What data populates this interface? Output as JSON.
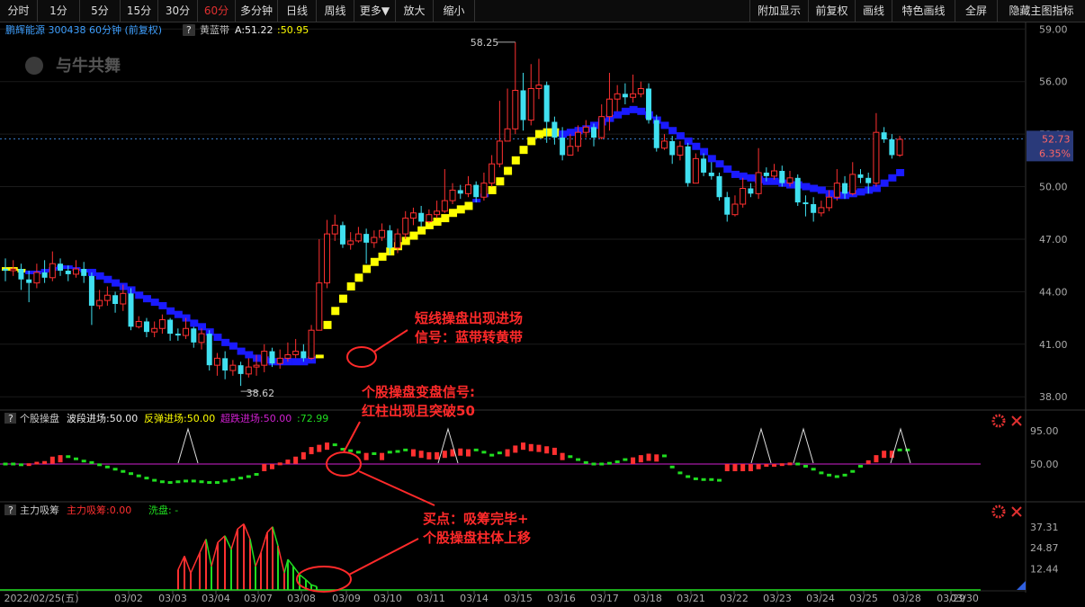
{
  "toolbar": {
    "left": [
      "分时",
      "1分",
      "5分",
      "15分",
      "30分",
      "60分",
      "多分钟",
      "日线",
      "周线",
      "更多▼",
      "放大",
      "缩小"
    ],
    "right": [
      "附加显示",
      "前复权",
      "画线",
      "特色画线",
      "全屏",
      "隐藏主图指标"
    ],
    "active": "60分"
  },
  "main": {
    "stock_title": "鹏辉能源 300438 60分钟 (前复权)",
    "help_icon": "?",
    "indicator_name": "黄蓝带",
    "value_a": "A:51.22",
    "value_b": ":50.95",
    "watermark": "与牛共舞",
    "high_label": "58.25",
    "low_label": "38.62",
    "current_price": "52.73",
    "current_pct": "6.35%",
    "y_ticks": [
      "59.00",
      "56.00",
      "53.00",
      "50.00",
      "47.00",
      "44.00",
      "41.00",
      "38.00"
    ]
  },
  "panel1": {
    "title": "个股操盘",
    "s1": "波段进场:50.00",
    "s2": "反弹进场:50.00",
    "s3": "超跌进场:50.00",
    "s4": ":72.99",
    "y_ticks": [
      "95.00",
      "50.00"
    ]
  },
  "panel2": {
    "title": "主力吸筹",
    "s1": "主力吸筹:0.00",
    "s2": "洗盘: -",
    "y_ticks": [
      "37.31",
      "24.87",
      "12.44"
    ]
  },
  "x_axis": [
    "2022/02/25(五)",
    "03/02",
    "03/03",
    "03/04",
    "03/07",
    "03/08",
    "03/09",
    "03/10",
    "03/11",
    "03/14",
    "03/15",
    "03/16",
    "03/17",
    "03/18",
    "03/21",
    "03/22",
    "03/23",
    "03/24",
    "03/25",
    "03/28",
    "03/29",
    "03/30"
  ],
  "annotations": {
    "a1_line1": "短线操盘出现进场",
    "a1_line2": "信号：蓝带转黄带",
    "a2_line1": "个股操盘变盘信号:",
    "a2_line2": "红柱出现且突破50",
    "a3_line1": "买点：吸筹完毕+",
    "a3_line2": "个股操盘柱体上移"
  },
  "colors": {
    "up": "#ff3030",
    "down": "#40e0f0",
    "yellow_band": "#ffff00",
    "blue_band": "#1a1aff",
    "magenta": "#d020d0",
    "green": "#20dd20",
    "annotation": "#ff2a2a"
  },
  "chart_data": {
    "type": "candlestick",
    "y_range": [
      38,
      59.5
    ],
    "candles": [
      [
        45.3,
        45.2,
        45.9,
        44.6
      ],
      [
        45.2,
        45.3,
        45.8,
        44.9
      ],
      [
        45.3,
        44.7,
        45.6,
        44.1
      ],
      [
        44.7,
        44.5,
        45.2,
        43.4
      ],
      [
        44.5,
        45.1,
        45.6,
        44.2
      ],
      [
        45.1,
        44.8,
        45.8,
        44.5
      ],
      [
        44.8,
        45.6,
        46.3,
        44.6
      ],
      [
        45.6,
        45.2,
        45.9,
        44.9
      ],
      [
        45.2,
        45.0,
        45.5,
        44.6
      ],
      [
        45.0,
        45.3,
        45.8,
        44.8
      ],
      [
        45.3,
        44.9,
        45.7,
        44.5
      ],
      [
        44.9,
        43.2,
        45.1,
        42.1
      ],
      [
        43.2,
        43.5,
        44.1,
        43.0
      ],
      [
        43.5,
        43.8,
        44.3,
        43.2
      ],
      [
        43.8,
        43.3,
        44.0,
        42.8
      ],
      [
        43.3,
        43.9,
        44.4,
        42.9
      ],
      [
        43.9,
        42.0,
        44.2,
        41.8
      ],
      [
        42.0,
        42.3,
        42.6,
        41.9
      ],
      [
        42.3,
        41.7,
        42.5,
        41.4
      ],
      [
        41.7,
        41.9,
        42.3,
        41.4
      ],
      [
        41.9,
        42.4,
        42.7,
        41.6
      ],
      [
        42.4,
        41.6,
        42.5,
        41.2
      ],
      [
        41.6,
        41.5,
        41.9,
        41.2
      ],
      [
        41.5,
        41.9,
        42.5,
        41.3
      ],
      [
        41.9,
        41.1,
        42.0,
        40.8
      ],
      [
        41.1,
        41.6,
        41.9,
        40.7
      ],
      [
        41.6,
        39.8,
        41.8,
        39.5
      ],
      [
        39.8,
        40.2,
        40.5,
        39.2
      ],
      [
        40.2,
        39.5,
        40.6,
        39.0
      ],
      [
        39.5,
        39.8,
        40.1,
        39.2
      ],
      [
        39.8,
        39.3,
        40.0,
        38.62
      ],
      [
        39.3,
        39.7,
        40.2,
        39.1
      ],
      [
        39.7,
        39.8,
        40.4,
        39.2
      ],
      [
        39.8,
        40.6,
        41.0,
        39.4
      ],
      [
        40.6,
        39.9,
        40.8,
        39.7
      ],
      [
        39.9,
        40.2,
        40.7,
        39.6
      ],
      [
        40.2,
        40.4,
        41.1,
        40.0
      ],
      [
        40.4,
        40.6,
        41.3,
        40.2
      ],
      [
        40.6,
        40.2,
        41.0,
        40.0
      ],
      [
        40.2,
        41.8,
        42.1,
        40.1
      ],
      [
        41.8,
        44.5,
        47.0,
        43.9
      ],
      [
        44.5,
        47.3,
        48.1,
        44.2
      ],
      [
        47.3,
        47.8,
        48.4,
        46.9
      ],
      [
        47.8,
        46.7,
        48.0,
        46.5
      ],
      [
        46.7,
        46.9,
        47.4,
        46.4
      ],
      [
        46.9,
        47.3,
        47.7,
        46.8
      ],
      [
        47.3,
        46.8,
        47.6,
        45.6
      ],
      [
        46.8,
        47.1,
        47.5,
        46.5
      ],
      [
        47.1,
        47.5,
        47.9,
        46.9
      ],
      [
        47.5,
        46.5,
        47.8,
        46.1
      ],
      [
        46.5,
        47.3,
        47.6,
        46.2
      ],
      [
        47.3,
        48.2,
        48.6,
        47.0
      ],
      [
        48.2,
        48.5,
        48.8,
        47.8
      ],
      [
        48.5,
        48.0,
        48.9,
        47.7
      ],
      [
        48.0,
        48.4,
        48.7,
        47.9
      ],
      [
        48.4,
        48.6,
        49.2,
        48.2
      ],
      [
        48.6,
        49.2,
        51.0,
        48.5
      ],
      [
        49.2,
        49.8,
        50.2,
        49.0
      ],
      [
        49.8,
        49.6,
        50.1,
        49.3
      ],
      [
        49.6,
        50.1,
        50.6,
        49.4
      ],
      [
        50.1,
        49.4,
        50.3,
        49.1
      ],
      [
        49.4,
        50.2,
        50.8,
        49.2
      ],
      [
        50.2,
        51.3,
        51.8,
        50.0
      ],
      [
        51.3,
        52.6,
        54.9,
        51.1
      ],
      [
        52.6,
        53.3,
        55.6,
        52.9
      ],
      [
        53.3,
        55.5,
        58.25,
        53.0
      ],
      [
        55.5,
        53.8,
        56.5,
        53.2
      ],
      [
        53.8,
        55.6,
        57.0,
        53.5
      ],
      [
        55.6,
        55.8,
        57.3,
        55.0
      ],
      [
        55.8,
        53.7,
        56.0,
        52.5
      ],
      [
        53.7,
        52.8,
        54.0,
        52.4
      ],
      [
        52.8,
        51.8,
        53.4,
        51.5
      ],
      [
        51.8,
        52.3,
        53.0,
        51.9
      ],
      [
        52.3,
        53.1,
        53.5,
        52.0
      ],
      [
        53.1,
        53.4,
        53.8,
        52.8
      ],
      [
        53.4,
        52.8,
        53.6,
        52.3
      ],
      [
        52.8,
        54.0,
        54.7,
        52.7
      ],
      [
        54.0,
        55.0,
        56.5,
        53.2
      ],
      [
        55.0,
        55.3,
        55.8,
        54.3
      ],
      [
        55.3,
        55.1,
        55.9,
        54.7
      ],
      [
        55.1,
        55.3,
        56.4,
        54.8
      ],
      [
        55.3,
        55.6,
        56.0,
        55.1
      ],
      [
        55.6,
        53.8,
        55.9,
        53.6
      ],
      [
        53.8,
        52.2,
        54.1,
        52.0
      ],
      [
        52.2,
        52.6,
        53.0,
        52.1
      ],
      [
        52.6,
        51.8,
        52.9,
        51.3
      ],
      [
        51.8,
        52.3,
        52.6,
        51.5
      ],
      [
        52.3,
        50.2,
        52.5,
        50.0
      ],
      [
        50.2,
        51.6,
        51.9,
        50.5
      ],
      [
        51.6,
        50.8,
        51.9,
        50.6
      ],
      [
        50.8,
        50.6,
        51.4,
        50.4
      ],
      [
        50.6,
        49.4,
        50.8,
        49.2
      ],
      [
        49.4,
        48.4,
        49.7,
        48.0
      ],
      [
        48.4,
        49.0,
        49.5,
        48.3
      ],
      [
        49.0,
        49.9,
        50.5,
        48.8
      ],
      [
        49.9,
        49.6,
        50.2,
        49.4
      ],
      [
        49.6,
        50.8,
        52.2,
        49.3
      ],
      [
        50.8,
        50.6,
        51.1,
        50.3
      ],
      [
        50.6,
        50.9,
        51.3,
        50.4
      ],
      [
        50.9,
        50.2,
        51.2,
        50.0
      ],
      [
        50.2,
        50.5,
        50.9,
        50.0
      ],
      [
        50.5,
        49.1,
        50.7,
        48.9
      ],
      [
        49.1,
        49.0,
        49.5,
        48.3
      ],
      [
        49.0,
        48.5,
        49.4,
        48.0
      ],
      [
        48.5,
        48.8,
        49.2,
        48.3
      ],
      [
        48.8,
        49.4,
        49.8,
        48.6
      ],
      [
        49.4,
        50.2,
        51.0,
        49.2
      ],
      [
        50.2,
        49.6,
        50.6,
        49.3
      ],
      [
        49.6,
        50.7,
        51.4,
        49.5
      ],
      [
        50.7,
        50.5,
        51.0,
        50.2
      ],
      [
        50.5,
        50.2,
        50.8,
        49.6
      ],
      [
        50.2,
        53.1,
        54.2,
        50.0
      ],
      [
        53.1,
        52.7,
        53.4,
        52.5
      ],
      [
        52.7,
        51.8,
        53.0,
        51.6
      ],
      [
        51.8,
        52.7,
        52.9,
        51.7
      ]
    ],
    "band": [
      45.3,
      45.3,
      45.2,
      45.1,
      45.1,
      45.2,
      45.3,
      45.4,
      45.4,
      45.3,
      45.2,
      45.1,
      44.9,
      44.7,
      44.5,
      44.3,
      44.1,
      43.8,
      43.6,
      43.4,
      43.2,
      42.9,
      42.7,
      42.5,
      42.2,
      42.0,
      41.7,
      41.4,
      41.1,
      40.9,
      40.6,
      40.4,
      40.2,
      40.1,
      40.0,
      40.0,
      40.0,
      40.0,
      40.0,
      40.1,
      40.3,
      42.1,
      42.9,
      43.6,
      44.3,
      44.8,
      45.3,
      45.7,
      46.0,
      46.3,
      46.6,
      46.9,
      47.2,
      47.5,
      47.8,
      48.0,
      48.2,
      48.5,
      48.7,
      48.9,
      49.2,
      49.5,
      49.8,
      50.3,
      50.9,
      51.5,
      52.1,
      52.6,
      53.0,
      53.1,
      53.1,
      53.0,
      53.1,
      53.2,
      53.3,
      53.5,
      53.7,
      53.9,
      54.1,
      54.3,
      54.4,
      54.3,
      54.1,
      53.8,
      53.5,
      53.2,
      52.9,
      52.6,
      52.3,
      52.0,
      51.6,
      51.3,
      51.0,
      50.7,
      50.6,
      50.5,
      50.4,
      50.3,
      50.3,
      50.2,
      50.1,
      50.1,
      50.0,
      49.9,
      49.8,
      49.6,
      49.5,
      49.5,
      49.6,
      49.7,
      49.8,
      49.9,
      50.2,
      50.5,
      50.8,
      51.2
    ],
    "band_yellow_from": [
      0,
      40,
      62
    ],
    "band_yellow_to": [
      2,
      59,
      70
    ],
    "op": [
      50,
      50,
      49,
      51,
      53,
      54,
      60,
      62,
      60,
      57,
      54,
      52,
      49,
      46,
      43,
      40,
      37,
      34,
      31,
      28,
      26,
      25,
      26,
      27,
      27,
      26,
      25,
      25,
      27,
      29,
      31,
      33,
      36,
      38,
      43,
      52,
      56,
      60,
      66,
      73,
      76,
      79,
      76,
      70,
      68,
      66,
      65,
      64,
      65,
      66,
      67,
      69,
      70,
      68,
      66,
      66,
      68,
      70,
      71,
      70,
      69,
      66,
      62,
      65,
      70,
      75,
      79,
      77,
      76,
      74,
      72,
      65,
      60,
      56,
      52,
      50,
      50,
      51,
      53,
      56,
      59,
      62,
      64,
      63,
      61,
      46,
      38,
      33,
      30,
      29,
      29,
      28,
      29,
      30,
      34,
      39,
      43,
      47,
      49,
      51,
      52,
      50,
      47,
      43,
      38,
      35,
      33,
      35,
      40,
      47,
      55,
      62,
      68,
      68,
      69,
      69
    ],
    "op_red": [
      3,
      4,
      5,
      6,
      7,
      33,
      34,
      35,
      36,
      37,
      38,
      39,
      40,
      41,
      46,
      48,
      52,
      53,
      54,
      55,
      56,
      57,
      58,
      59,
      64,
      65,
      66,
      67,
      68,
      69,
      70,
      71,
      80,
      81,
      82,
      83,
      92,
      93,
      94,
      95,
      96,
      97,
      98,
      99,
      100,
      110,
      111,
      112,
      113
    ],
    "tri_x": [
      209,
      498,
      846,
      893,
      1001
    ],
    "acc": [
      0,
      0,
      0,
      0,
      0,
      0,
      0,
      0,
      0,
      0,
      0,
      0,
      0,
      0,
      0,
      0,
      0,
      0,
      0,
      0,
      0,
      0,
      0,
      0,
      0,
      0,
      0,
      0,
      0,
      0,
      0,
      0,
      0,
      0,
      0,
      0,
      0,
      0,
      0,
      0,
      0,
      0,
      0,
      0,
      0,
      0,
      0,
      0,
      0,
      0,
      0,
      0,
      0,
      0,
      0,
      0,
      0,
      0,
      0,
      0,
      0,
      0,
      0,
      0,
      0,
      0,
      0,
      0,
      0,
      0,
      0,
      0,
      0,
      0,
      0,
      0,
      0,
      0,
      0,
      0,
      0,
      0,
      0,
      0,
      0,
      0,
      0,
      0,
      0,
      0,
      0,
      0,
      0,
      0,
      0,
      0,
      0,
      0,
      0,
      0,
      0,
      0,
      0,
      0,
      0,
      0,
      0,
      0,
      0,
      0,
      0,
      0,
      0,
      0,
      0,
      0,
      0,
      0
    ],
    "acc_bars": [
      [
        198,
        12,
        "r"
      ],
      [
        205,
        20,
        "r"
      ],
      [
        212,
        10,
        "r"
      ],
      [
        222,
        22,
        "r"
      ],
      [
        229,
        30,
        "r"
      ],
      [
        235,
        14,
        "g"
      ],
      [
        242,
        28,
        "r"
      ],
      [
        250,
        32,
        "r"
      ],
      [
        257,
        24,
        "g"
      ],
      [
        264,
        36,
        "r"
      ],
      [
        271,
        39,
        "r"
      ],
      [
        278,
        30,
        "r"
      ],
      [
        284,
        14,
        "g"
      ],
      [
        290,
        22,
        "r"
      ],
      [
        297,
        34,
        "r"
      ],
      [
        303,
        37.31,
        "r"
      ],
      [
        309,
        26,
        "g"
      ],
      [
        316,
        10,
        "r"
      ],
      [
        320,
        18,
        "g"
      ],
      [
        326,
        14,
        "g"
      ],
      [
        333,
        9,
        "g"
      ],
      [
        340,
        6,
        "g"
      ],
      [
        346,
        3,
        "g"
      ],
      [
        352,
        2,
        "g"
      ]
    ],
    "acc_ylim": [
      0,
      42
    ],
    "x_tick_pos": [
      46,
      143,
      192,
      240,
      287,
      335,
      385,
      431,
      479,
      527,
      576,
      624,
      672,
      720,
      768,
      816,
      864,
      912,
      960,
      1008,
      1057,
      1072
    ]
  }
}
